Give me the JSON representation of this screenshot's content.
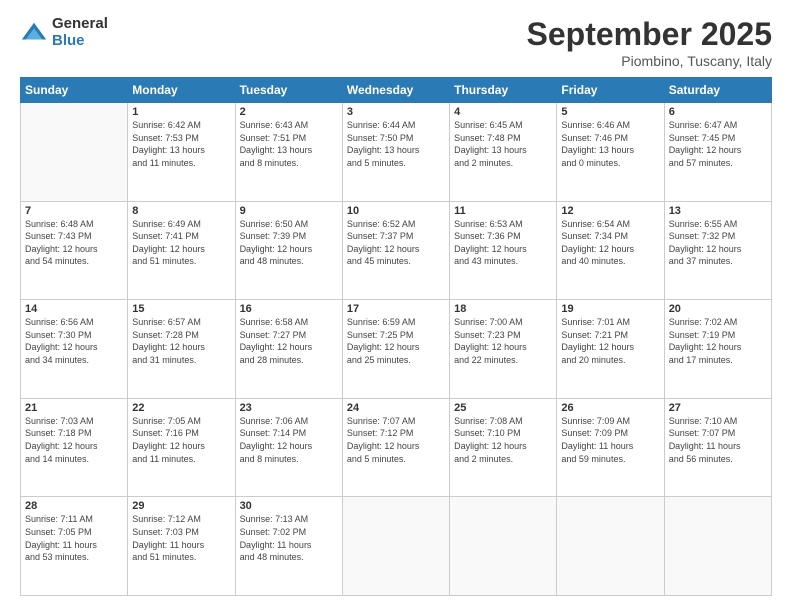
{
  "logo": {
    "general": "General",
    "blue": "Blue"
  },
  "title": {
    "month": "September 2025",
    "location": "Piombino, Tuscany, Italy"
  },
  "headers": [
    "Sunday",
    "Monday",
    "Tuesday",
    "Wednesday",
    "Thursday",
    "Friday",
    "Saturday"
  ],
  "weeks": [
    [
      {
        "day": "",
        "info": ""
      },
      {
        "day": "1",
        "info": "Sunrise: 6:42 AM\nSunset: 7:53 PM\nDaylight: 13 hours\nand 11 minutes."
      },
      {
        "day": "2",
        "info": "Sunrise: 6:43 AM\nSunset: 7:51 PM\nDaylight: 13 hours\nand 8 minutes."
      },
      {
        "day": "3",
        "info": "Sunrise: 6:44 AM\nSunset: 7:50 PM\nDaylight: 13 hours\nand 5 minutes."
      },
      {
        "day": "4",
        "info": "Sunrise: 6:45 AM\nSunset: 7:48 PM\nDaylight: 13 hours\nand 2 minutes."
      },
      {
        "day": "5",
        "info": "Sunrise: 6:46 AM\nSunset: 7:46 PM\nDaylight: 13 hours\nand 0 minutes."
      },
      {
        "day": "6",
        "info": "Sunrise: 6:47 AM\nSunset: 7:45 PM\nDaylight: 12 hours\nand 57 minutes."
      }
    ],
    [
      {
        "day": "7",
        "info": "Sunrise: 6:48 AM\nSunset: 7:43 PM\nDaylight: 12 hours\nand 54 minutes."
      },
      {
        "day": "8",
        "info": "Sunrise: 6:49 AM\nSunset: 7:41 PM\nDaylight: 12 hours\nand 51 minutes."
      },
      {
        "day": "9",
        "info": "Sunrise: 6:50 AM\nSunset: 7:39 PM\nDaylight: 12 hours\nand 48 minutes."
      },
      {
        "day": "10",
        "info": "Sunrise: 6:52 AM\nSunset: 7:37 PM\nDaylight: 12 hours\nand 45 minutes."
      },
      {
        "day": "11",
        "info": "Sunrise: 6:53 AM\nSunset: 7:36 PM\nDaylight: 12 hours\nand 43 minutes."
      },
      {
        "day": "12",
        "info": "Sunrise: 6:54 AM\nSunset: 7:34 PM\nDaylight: 12 hours\nand 40 minutes."
      },
      {
        "day": "13",
        "info": "Sunrise: 6:55 AM\nSunset: 7:32 PM\nDaylight: 12 hours\nand 37 minutes."
      }
    ],
    [
      {
        "day": "14",
        "info": "Sunrise: 6:56 AM\nSunset: 7:30 PM\nDaylight: 12 hours\nand 34 minutes."
      },
      {
        "day": "15",
        "info": "Sunrise: 6:57 AM\nSunset: 7:28 PM\nDaylight: 12 hours\nand 31 minutes."
      },
      {
        "day": "16",
        "info": "Sunrise: 6:58 AM\nSunset: 7:27 PM\nDaylight: 12 hours\nand 28 minutes."
      },
      {
        "day": "17",
        "info": "Sunrise: 6:59 AM\nSunset: 7:25 PM\nDaylight: 12 hours\nand 25 minutes."
      },
      {
        "day": "18",
        "info": "Sunrise: 7:00 AM\nSunset: 7:23 PM\nDaylight: 12 hours\nand 22 minutes."
      },
      {
        "day": "19",
        "info": "Sunrise: 7:01 AM\nSunset: 7:21 PM\nDaylight: 12 hours\nand 20 minutes."
      },
      {
        "day": "20",
        "info": "Sunrise: 7:02 AM\nSunset: 7:19 PM\nDaylight: 12 hours\nand 17 minutes."
      }
    ],
    [
      {
        "day": "21",
        "info": "Sunrise: 7:03 AM\nSunset: 7:18 PM\nDaylight: 12 hours\nand 14 minutes."
      },
      {
        "day": "22",
        "info": "Sunrise: 7:05 AM\nSunset: 7:16 PM\nDaylight: 12 hours\nand 11 minutes."
      },
      {
        "day": "23",
        "info": "Sunrise: 7:06 AM\nSunset: 7:14 PM\nDaylight: 12 hours\nand 8 minutes."
      },
      {
        "day": "24",
        "info": "Sunrise: 7:07 AM\nSunset: 7:12 PM\nDaylight: 12 hours\nand 5 minutes."
      },
      {
        "day": "25",
        "info": "Sunrise: 7:08 AM\nSunset: 7:10 PM\nDaylight: 12 hours\nand 2 minutes."
      },
      {
        "day": "26",
        "info": "Sunrise: 7:09 AM\nSunset: 7:09 PM\nDaylight: 11 hours\nand 59 minutes."
      },
      {
        "day": "27",
        "info": "Sunrise: 7:10 AM\nSunset: 7:07 PM\nDaylight: 11 hours\nand 56 minutes."
      }
    ],
    [
      {
        "day": "28",
        "info": "Sunrise: 7:11 AM\nSunset: 7:05 PM\nDaylight: 11 hours\nand 53 minutes."
      },
      {
        "day": "29",
        "info": "Sunrise: 7:12 AM\nSunset: 7:03 PM\nDaylight: 11 hours\nand 51 minutes."
      },
      {
        "day": "30",
        "info": "Sunrise: 7:13 AM\nSunset: 7:02 PM\nDaylight: 11 hours\nand 48 minutes."
      },
      {
        "day": "",
        "info": ""
      },
      {
        "day": "",
        "info": ""
      },
      {
        "day": "",
        "info": ""
      },
      {
        "day": "",
        "info": ""
      }
    ]
  ]
}
